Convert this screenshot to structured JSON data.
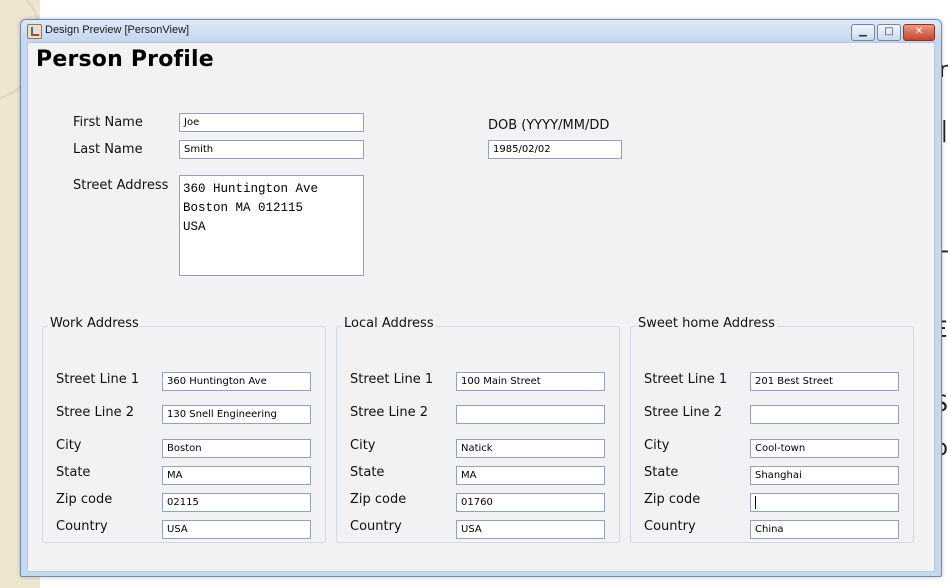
{
  "window": {
    "title": "Design Preview [PersonView]",
    "controls": {
      "minimize": "▁",
      "maximize": "□",
      "close": "✕"
    }
  },
  "page_title": "Person Profile",
  "person": {
    "first_name_label": "First Name",
    "first_name_value": "Joe",
    "last_name_label": "Last Name",
    "last_name_value": "Smith",
    "street_address_label": "Street Address",
    "street_address_value": "360 Huntington Ave\nBoston MA 012115\nUSA",
    "dob_label": "DOB (YYYY/MM/DD",
    "dob_value": "1985/02/02"
  },
  "labels": {
    "street1": "Street Line 1",
    "street2": "Stree Line 2",
    "city": "City",
    "state": "State",
    "zip": "Zip code",
    "country": "Country"
  },
  "work_address": {
    "title": "Work Address",
    "street1": "360 Huntington Ave",
    "street2": "130 Snell Engineering",
    "city": "Boston",
    "state": "MA",
    "zip": "02115",
    "country": "USA"
  },
  "local_address": {
    "title": "Local Address",
    "street1": "100 Main Street",
    "street2": "",
    "city": "Natick",
    "state": "MA",
    "zip": "01760",
    "country": "USA"
  },
  "home_address": {
    "title": "Sweet home Address",
    "street1": "201 Best Street",
    "street2": "",
    "city": "Cool-town",
    "state": "Shanghai",
    "zip": "",
    "country": "China"
  },
  "colors": {
    "titlebar": "#c4d6ee",
    "content_bg": "#f2f2f5",
    "field_border": "#8fa3be",
    "close_button": "#c5452b"
  }
}
